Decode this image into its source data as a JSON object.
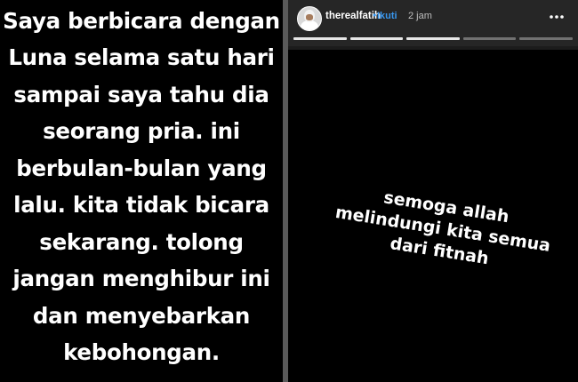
{
  "left_story": {
    "lines": [
      "Saya berbicara dengan",
      "Luna selama satu hari",
      "sampai saya tahu dia",
      "seorang pria. ini",
      "berbulan-bulan yang",
      "lalu. kita tidak bicara",
      "sekarang. tolong",
      "jangan menghibur ini",
      "dan menyebarkan",
      "kebohongan."
    ]
  },
  "right_story": {
    "header": {
      "username": "therealfatih",
      "separator": "•",
      "follow_label": "Ikuti",
      "timestamp": "2 jam",
      "more_icon": "more-horizontal-icon",
      "avatar": "profile-avatar"
    },
    "progress": {
      "total": 5,
      "current": 3
    },
    "text_lines": [
      "semoga allah",
      "melindungi kita semua",
      "dari fitnah"
    ]
  },
  "colors": {
    "follow_blue": "#3897f0",
    "background": "#000000",
    "header_bg": "#262626"
  }
}
